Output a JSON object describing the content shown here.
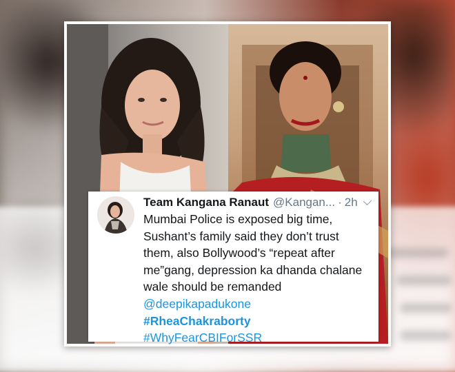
{
  "tweet": {
    "name": "Team Kangana Ranaut",
    "handle": "@Kangan...",
    "separator": "·",
    "time": "2h",
    "lines": [
      "Mumbai Police is exposed big time,",
      "Sushant’s family said they don’t trust",
      "them, also Bollywood’s “repeat after",
      "me”gang, depression ka dhanda chalane",
      "wale should be remanded"
    ],
    "mention": "@deepikapadukone",
    "hashtags": [
      "#RheaChakraborty",
      "#WhyFearCBIForSSR"
    ]
  },
  "colors": {
    "link": "#1b95e0",
    "muted": "#657786",
    "text": "#14171a"
  }
}
